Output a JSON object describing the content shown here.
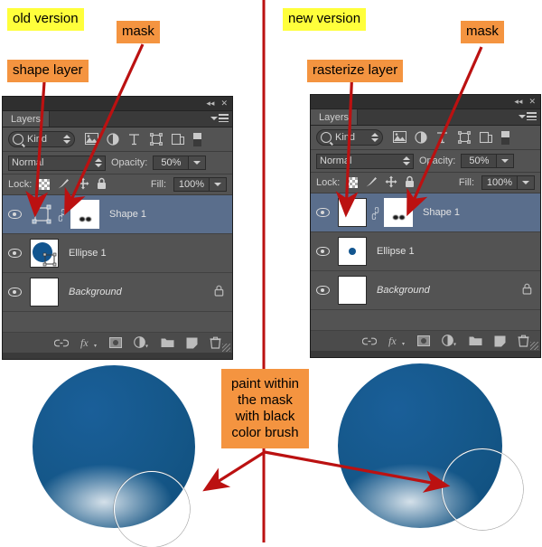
{
  "annotations": {
    "old_version": "old version",
    "new_version": "new version",
    "mask_left": "mask",
    "mask_right": "mask",
    "shape_layer": "shape layer",
    "rasterize_layer": "rasterize layer",
    "paint_note": "paint within\nthe mask\nwith black\ncolor brush"
  },
  "colors": {
    "highlight_yellow": "#ffff3b",
    "callout_orange": "#f49440",
    "arrow_red": "#bb1111",
    "divider_red": "#bb1111",
    "panel_bg": "#535353",
    "selected_row": "#5a6e8c",
    "shape_blue": "#12558f"
  },
  "left_panel": {
    "titlebar": {
      "collapse_icon": "collapse-icon",
      "close_icon": "close-icon"
    },
    "tab": "Layers",
    "menu_icon": "panel-menu-icon",
    "filter": {
      "search_icon": "search-icon",
      "kind_label": "Kind",
      "stepper_icon": "stepper-icon",
      "icons": [
        "pixel-filter-icon",
        "adjustment-filter-icon",
        "type-filter-icon",
        "shape-filter-icon",
        "smartobject-filter-icon",
        "filter-toggle-icon"
      ]
    },
    "blend": {
      "mode": "Normal",
      "opacity_label": "Opacity:",
      "opacity_value": "50%",
      "opacity_dropdown_icon": "chevron-down-icon"
    },
    "lock": {
      "label": "Lock:",
      "icons": [
        "lock-transparent-pixels-icon",
        "lock-image-pixels-icon",
        "lock-position-icon",
        "lock-all-icon"
      ],
      "fill_label": "Fill:",
      "fill_value": "100%",
      "fill_dropdown_icon": "chevron-down-icon"
    },
    "layers": [
      {
        "name": "Shape 1",
        "selected": true,
        "visible": true,
        "locked": false,
        "italic": false,
        "thumb_type": "vector-shape",
        "has_link": true,
        "has_mask": true
      },
      {
        "name": "Ellipse 1",
        "selected": false,
        "visible": true,
        "locked": false,
        "italic": false,
        "thumb_type": "blue-circle-vector",
        "has_link": false,
        "has_mask": false
      },
      {
        "name": "Background",
        "selected": false,
        "visible": true,
        "locked": true,
        "italic": true,
        "thumb_type": "white",
        "has_link": false,
        "has_mask": false
      }
    ],
    "bottom_icons": [
      "link-layers-icon",
      "layer-style-fx-icon",
      "add-layer-mask-icon",
      "new-adjustment-layer-icon",
      "new-group-icon",
      "new-layer-icon",
      "delete-layer-icon"
    ]
  },
  "right_panel": {
    "titlebar": {
      "collapse_icon": "collapse-icon",
      "close_icon": "close-icon"
    },
    "tab": "Layers",
    "menu_icon": "panel-menu-icon",
    "filter": {
      "search_icon": "search-icon",
      "kind_label": "Kind",
      "stepper_icon": "stepper-icon",
      "icons": [
        "pixel-filter-icon",
        "adjustment-filter-icon",
        "type-filter-icon",
        "shape-filter-icon",
        "smartobject-filter-icon",
        "filter-toggle-icon"
      ]
    },
    "blend": {
      "mode": "Normal",
      "opacity_label": "Opacity:",
      "opacity_value": "50%",
      "opacity_dropdown_icon": "chevron-down-icon"
    },
    "lock": {
      "label": "Lock:",
      "icons": [
        "lock-transparent-pixels-icon",
        "lock-image-pixels-icon",
        "lock-position-icon",
        "lock-all-icon"
      ],
      "fill_label": "Fill:",
      "fill_value": "100%",
      "fill_dropdown_icon": "chevron-down-icon"
    },
    "layers": [
      {
        "name": "Shape 1",
        "selected": true,
        "visible": true,
        "locked": false,
        "italic": false,
        "thumb_type": "transparent",
        "has_link": true,
        "has_mask": true
      },
      {
        "name": "Ellipse 1",
        "selected": false,
        "visible": true,
        "locked": false,
        "italic": false,
        "thumb_type": "transparent-dot",
        "has_link": false,
        "has_mask": false
      },
      {
        "name": "Background",
        "selected": false,
        "visible": true,
        "locked": true,
        "italic": true,
        "thumb_type": "white",
        "has_link": false,
        "has_mask": false
      }
    ],
    "bottom_icons": [
      "link-layers-icon",
      "layer-style-fx-icon",
      "add-layer-mask-icon",
      "new-adjustment-layer-icon",
      "new-group-icon",
      "new-layer-icon",
      "delete-layer-icon"
    ]
  },
  "artwork": {
    "left_circle": {
      "name": "blue-sphere-old",
      "brush_cursor": "brush-cursor-outline"
    },
    "right_circle": {
      "name": "blue-sphere-new",
      "brush_cursor": "brush-cursor-outline"
    }
  }
}
